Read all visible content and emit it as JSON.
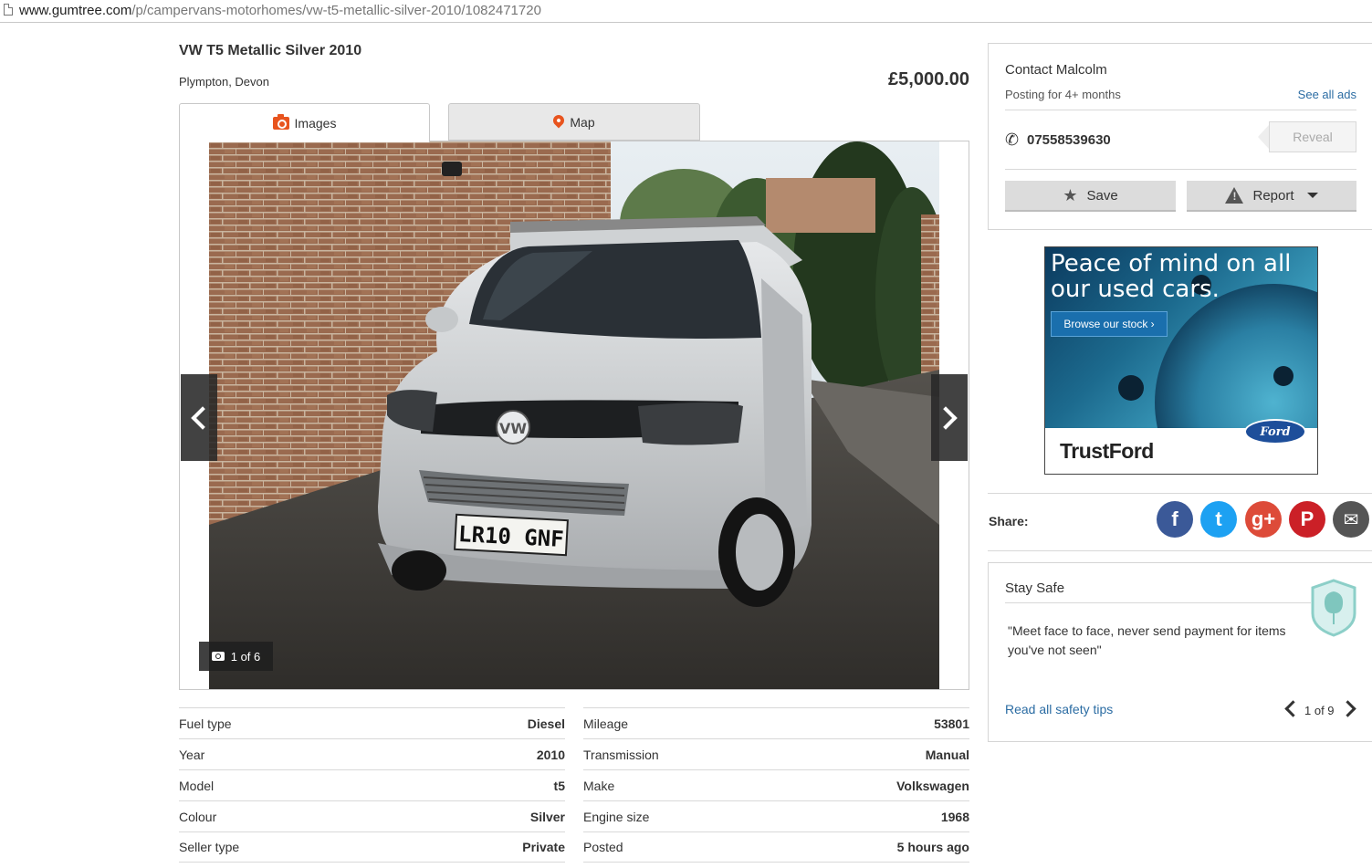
{
  "browser": {
    "url_host": "www.gumtree.com",
    "url_path": "/p/campervans-motorhomes/vw-t5-metallic-silver-2010/1082471720"
  },
  "listing": {
    "title": "VW T5 Metallic Silver 2010",
    "location": "Plympton, Devon",
    "price": "£5,000.00"
  },
  "tabs": {
    "images": "Images",
    "map": "Map"
  },
  "gallery": {
    "counter": "1 of 6",
    "plate": "LR10 GNF"
  },
  "attributes": {
    "left": [
      {
        "key": "Fuel type",
        "value": "Diesel"
      },
      {
        "key": "Year",
        "value": "2010"
      },
      {
        "key": "Model",
        "value": "t5"
      },
      {
        "key": "Colour",
        "value": "Silver"
      },
      {
        "key": "Seller type",
        "value": "Private"
      }
    ],
    "right": [
      {
        "key": "Mileage",
        "value": "53801"
      },
      {
        "key": "Transmission",
        "value": "Manual"
      },
      {
        "key": "Make",
        "value": "Volkswagen"
      },
      {
        "key": "Engine size",
        "value": "1968"
      },
      {
        "key": "Posted",
        "value": "5 hours ago"
      }
    ]
  },
  "contact": {
    "name": "Contact Malcolm",
    "posting": "Posting for 4+ months",
    "see_all": "See all ads",
    "phone": "07558539630",
    "reveal": "Reveal",
    "save": "Save",
    "report": "Report"
  },
  "ad": {
    "headline": "Peace of mind on all our used cars.",
    "button": "Browse our stock ›",
    "brand": "TrustFord",
    "logo": "Ford"
  },
  "share": {
    "label": "Share:",
    "icons": [
      {
        "name": "facebook-icon",
        "glyph": "f",
        "color": "#3b5998"
      },
      {
        "name": "twitter-icon",
        "glyph": "t",
        "color": "#1da1f2"
      },
      {
        "name": "google-plus-icon",
        "glyph": "g+",
        "color": "#dd4b39"
      },
      {
        "name": "pinterest-icon",
        "glyph": "P",
        "color": "#cb2027"
      },
      {
        "name": "email-icon",
        "glyph": "✉",
        "color": "#555555"
      }
    ]
  },
  "safety": {
    "title": "Stay Safe",
    "quote": "\"Meet face to face, never send payment for items you've not seen\"",
    "link": "Read all safety tips",
    "pager": "1 of 9"
  },
  "colors": {
    "accent": "#e8541e",
    "link": "#2b6ca3"
  }
}
